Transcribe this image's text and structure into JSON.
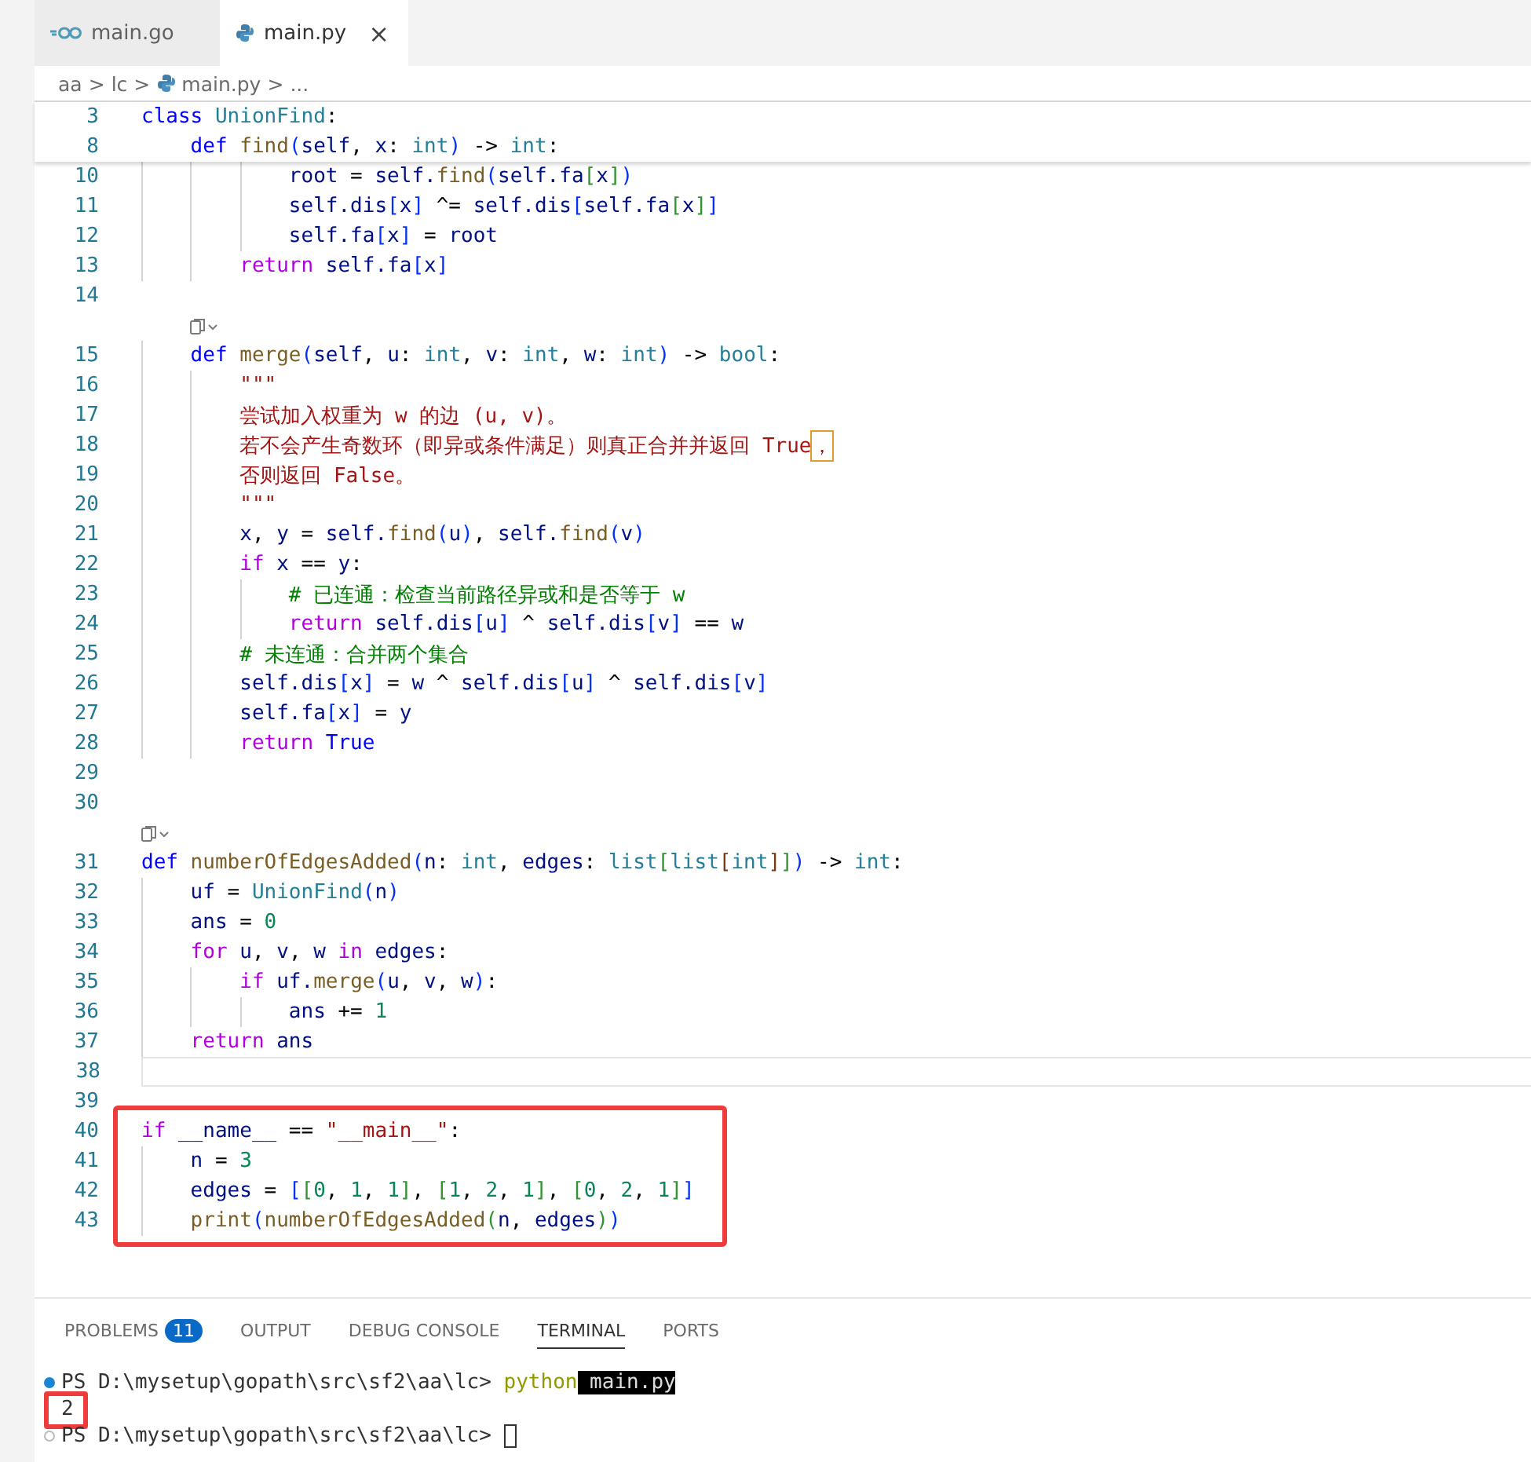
{
  "tabs": [
    {
      "label": "main.go",
      "selected": false
    },
    {
      "label": "main.py",
      "selected": true,
      "close": "×"
    }
  ],
  "breadcrumb": [
    {
      "label": "aa",
      "kind": "folder"
    },
    {
      "label": "lc",
      "kind": "folder"
    },
    {
      "label": "main.py",
      "kind": "file"
    },
    {
      "label": "...",
      "kind": "more"
    }
  ],
  "breadcrumb_separator": ">",
  "sticky_lines": [
    {
      "number": "3",
      "tokens": [
        {
          "text": "class",
          "kind": "kw"
        },
        {
          "text": " UnionFind",
          "kind": "cls"
        },
        {
          "text": ":",
          "kind": "p"
        }
      ]
    },
    {
      "number": "8",
      "tokens": [
        {
          "text": "    def",
          "kind": "kw"
        },
        {
          "text": " find",
          "kind": "fn"
        },
        {
          "text": "(",
          "kind": "br1"
        },
        {
          "text": "self",
          "kind": "var"
        },
        {
          "text": ", ",
          "kind": "p"
        },
        {
          "text": "x",
          "kind": "var"
        },
        {
          "text": ": ",
          "kind": "p"
        },
        {
          "text": "int",
          "kind": "cls"
        },
        {
          "text": ")",
          "kind": "br1"
        },
        {
          "text": " -> ",
          "kind": "p"
        },
        {
          "text": "int",
          "kind": "cls"
        },
        {
          "text": ":",
          "kind": "p"
        }
      ]
    }
  ],
  "blocks": [
    {
      "annotated": false,
      "lines": [
        {
          "kind": "code",
          "number": "10",
          "tokens": [
            {
              "text": "            root",
              "kind": "var"
            },
            {
              "text": " = ",
              "kind": "p"
            },
            {
              "text": "self.",
              "kind": "var"
            },
            {
              "text": "find",
              "kind": "fn"
            },
            {
              "text": "(",
              "kind": "br1"
            },
            {
              "text": "self.fa",
              "kind": "var"
            },
            {
              "text": "[",
              "kind": "br2"
            },
            {
              "text": "x",
              "kind": "var"
            },
            {
              "text": "]",
              "kind": "br2"
            },
            {
              "text": ")",
              "kind": "br1"
            }
          ]
        },
        {
          "kind": "code",
          "number": "11",
          "tokens": [
            {
              "text": "            self.dis",
              "kind": "var"
            },
            {
              "text": "[",
              "kind": "br1"
            },
            {
              "text": "x",
              "kind": "var"
            },
            {
              "text": "]",
              "kind": "br1"
            },
            {
              "text": " ^= ",
              "kind": "p"
            },
            {
              "text": "self.dis",
              "kind": "var"
            },
            {
              "text": "[",
              "kind": "br1"
            },
            {
              "text": "self.fa",
              "kind": "var"
            },
            {
              "text": "[",
              "kind": "br2"
            },
            {
              "text": "x",
              "kind": "var"
            },
            {
              "text": "]",
              "kind": "br2"
            },
            {
              "text": "]",
              "kind": "br1"
            }
          ]
        },
        {
          "kind": "code",
          "number": "12",
          "tokens": [
            {
              "text": "            self.fa",
              "kind": "var"
            },
            {
              "text": "[",
              "kind": "br1"
            },
            {
              "text": "x",
              "kind": "var"
            },
            {
              "text": "]",
              "kind": "br1"
            },
            {
              "text": " = ",
              "kind": "p"
            },
            {
              "text": "root",
              "kind": "var"
            }
          ]
        },
        {
          "kind": "code",
          "number": "13",
          "tokens": [
            {
              "text": "        return",
              "kind": "ctrl"
            },
            {
              "text": " self.fa",
              "kind": "var"
            },
            {
              "text": "[",
              "kind": "br1"
            },
            {
              "text": "x",
              "kind": "var"
            },
            {
              "text": "]",
              "kind": "br1"
            }
          ]
        },
        {
          "kind": "code",
          "number": "14"
        },
        {
          "kind": "codelens",
          "nested": true
        },
        {
          "kind": "code",
          "number": "15",
          "tokens": [
            {
              "text": "    def",
              "kind": "kw"
            },
            {
              "text": " merge",
              "kind": "fn"
            },
            {
              "text": "(",
              "kind": "br1"
            },
            {
              "text": "self",
              "kind": "var"
            },
            {
              "text": ", ",
              "kind": "p"
            },
            {
              "text": "u",
              "kind": "var"
            },
            {
              "text": ": ",
              "kind": "p"
            },
            {
              "text": "int",
              "kind": "cls"
            },
            {
              "text": ", ",
              "kind": "p"
            },
            {
              "text": "v",
              "kind": "var"
            },
            {
              "text": ": ",
              "kind": "p"
            },
            {
              "text": "int",
              "kind": "cls"
            },
            {
              "text": ", ",
              "kind": "p"
            },
            {
              "text": "w",
              "kind": "var"
            },
            {
              "text": ": ",
              "kind": "p"
            },
            {
              "text": "int",
              "kind": "cls"
            },
            {
              "text": ")",
              "kind": "br1"
            },
            {
              "text": " -> ",
              "kind": "p"
            },
            {
              "text": "bool",
              "kind": "cls"
            },
            {
              "text": ":",
              "kind": "p"
            }
          ]
        },
        {
          "kind": "code",
          "number": "16",
          "tokens": [
            {
              "text": "        \"\"\"",
              "kind": "str"
            }
          ]
        },
        {
          "kind": "code",
          "number": "17",
          "tokens": [
            {
              "text": "        尝试加入权重为 w 的边 (u, v)。",
              "kind": "str"
            }
          ]
        },
        {
          "kind": "code",
          "number": "18",
          "tokens": [
            {
              "text": "        若不会产生奇数环（即异或条件满足）则真正合并并返回 True",
              "kind": "str"
            },
            {
              "text": "，",
              "kind": "str",
              "boxed": true
            }
          ]
        },
        {
          "kind": "code",
          "number": "19",
          "tokens": [
            {
              "text": "        否则返回 False。",
              "kind": "str"
            }
          ]
        },
        {
          "kind": "code",
          "number": "20",
          "tokens": [
            {
              "text": "        \"\"\"",
              "kind": "str"
            }
          ]
        },
        {
          "kind": "code",
          "number": "21",
          "tokens": [
            {
              "text": "        x",
              "kind": "var"
            },
            {
              "text": ", ",
              "kind": "p"
            },
            {
              "text": "y",
              "kind": "var"
            },
            {
              "text": " = ",
              "kind": "p"
            },
            {
              "text": "self.",
              "kind": "var"
            },
            {
              "text": "find",
              "kind": "fn"
            },
            {
              "text": "(",
              "kind": "br1"
            },
            {
              "text": "u",
              "kind": "var"
            },
            {
              "text": ")",
              "kind": "br1"
            },
            {
              "text": ", ",
              "kind": "p"
            },
            {
              "text": "self.",
              "kind": "var"
            },
            {
              "text": "find",
              "kind": "fn"
            },
            {
              "text": "(",
              "kind": "br1"
            },
            {
              "text": "v",
              "kind": "var"
            },
            {
              "text": ")",
              "kind": "br1"
            }
          ]
        },
        {
          "kind": "code",
          "number": "22",
          "tokens": [
            {
              "text": "        if",
              "kind": "ctrl"
            },
            {
              "text": " x",
              "kind": "var"
            },
            {
              "text": " == ",
              "kind": "p"
            },
            {
              "text": "y",
              "kind": "var"
            },
            {
              "text": ":",
              "kind": "p"
            }
          ]
        },
        {
          "kind": "code",
          "number": "23",
          "tokens": [
            {
              "text": "            # 已连通：检查当前路径异或和是否等于 w",
              "kind": "cmt"
            }
          ]
        },
        {
          "kind": "code",
          "number": "24",
          "tokens": [
            {
              "text": "            return",
              "kind": "ctrl"
            },
            {
              "text": " self.dis",
              "kind": "var"
            },
            {
              "text": "[",
              "kind": "br1"
            },
            {
              "text": "u",
              "kind": "var"
            },
            {
              "text": "]",
              "kind": "br1"
            },
            {
              "text": " ^ ",
              "kind": "p"
            },
            {
              "text": "self.dis",
              "kind": "var"
            },
            {
              "text": "[",
              "kind": "br1"
            },
            {
              "text": "v",
              "kind": "var"
            },
            {
              "text": "]",
              "kind": "br1"
            },
            {
              "text": " == ",
              "kind": "p"
            },
            {
              "text": "w",
              "kind": "var"
            }
          ]
        },
        {
          "kind": "code",
          "number": "25",
          "tokens": [
            {
              "text": "        # 未连通：合并两个集合",
              "kind": "cmt"
            }
          ]
        },
        {
          "kind": "code",
          "number": "26",
          "tokens": [
            {
              "text": "        self.dis",
              "kind": "var"
            },
            {
              "text": "[",
              "kind": "br1"
            },
            {
              "text": "x",
              "kind": "var"
            },
            {
              "text": "]",
              "kind": "br1"
            },
            {
              "text": " = ",
              "kind": "p"
            },
            {
              "text": "w",
              "kind": "var"
            },
            {
              "text": " ^ ",
              "kind": "p"
            },
            {
              "text": "self.dis",
              "kind": "var"
            },
            {
              "text": "[",
              "kind": "br1"
            },
            {
              "text": "u",
              "kind": "var"
            },
            {
              "text": "]",
              "kind": "br1"
            },
            {
              "text": " ^ ",
              "kind": "p"
            },
            {
              "text": "self.dis",
              "kind": "var"
            },
            {
              "text": "[",
              "kind": "br1"
            },
            {
              "text": "v",
              "kind": "var"
            },
            {
              "text": "]",
              "kind": "br1"
            }
          ]
        },
        {
          "kind": "code",
          "number": "27",
          "tokens": [
            {
              "text": "        self.fa",
              "kind": "var"
            },
            {
              "text": "[",
              "kind": "br1"
            },
            {
              "text": "x",
              "kind": "var"
            },
            {
              "text": "]",
              "kind": "br1"
            },
            {
              "text": " = ",
              "kind": "p"
            },
            {
              "text": "y",
              "kind": "var"
            }
          ]
        },
        {
          "kind": "code",
          "number": "28",
          "tokens": [
            {
              "text": "        return",
              "kind": "ctrl"
            },
            {
              "text": " True",
              "kind": "kw"
            }
          ]
        },
        {
          "kind": "code",
          "number": "29"
        },
        {
          "kind": "code",
          "number": "30"
        },
        {
          "kind": "codelens",
          "nested": false
        },
        {
          "kind": "code",
          "number": "31",
          "tokens": [
            {
              "text": "def",
              "kind": "kw"
            },
            {
              "text": " numberOfEdgesAdded",
              "kind": "fn"
            },
            {
              "text": "(",
              "kind": "br1"
            },
            {
              "text": "n",
              "kind": "var"
            },
            {
              "text": ": ",
              "kind": "p"
            },
            {
              "text": "int",
              "kind": "cls"
            },
            {
              "text": ", ",
              "kind": "p"
            },
            {
              "text": "edges",
              "kind": "var"
            },
            {
              "text": ": ",
              "kind": "p"
            },
            {
              "text": "list",
              "kind": "cls"
            },
            {
              "text": "[",
              "kind": "br2"
            },
            {
              "text": "list",
              "kind": "cls"
            },
            {
              "text": "[",
              "kind": "br3"
            },
            {
              "text": "int",
              "kind": "cls"
            },
            {
              "text": "]",
              "kind": "br3"
            },
            {
              "text": "]",
              "kind": "br2"
            },
            {
              "text": ")",
              "kind": "br1"
            },
            {
              "text": " -> ",
              "kind": "p"
            },
            {
              "text": "int",
              "kind": "cls"
            },
            {
              "text": ":",
              "kind": "p"
            }
          ]
        },
        {
          "kind": "code",
          "number": "32",
          "tokens": [
            {
              "text": "    uf",
              "kind": "var"
            },
            {
              "text": " = ",
              "kind": "p"
            },
            {
              "text": "UnionFind",
              "kind": "cls"
            },
            {
              "text": "(",
              "kind": "br1"
            },
            {
              "text": "n",
              "kind": "var"
            },
            {
              "text": ")",
              "kind": "br1"
            }
          ]
        },
        {
          "kind": "code",
          "number": "33",
          "tokens": [
            {
              "text": "    ans",
              "kind": "var"
            },
            {
              "text": " = ",
              "kind": "p"
            },
            {
              "text": "0",
              "kind": "num"
            }
          ]
        },
        {
          "kind": "code",
          "number": "34",
          "tokens": [
            {
              "text": "    for",
              "kind": "ctrl"
            },
            {
              "text": " u",
              "kind": "var"
            },
            {
              "text": ", ",
              "kind": "p"
            },
            {
              "text": "v",
              "kind": "var"
            },
            {
              "text": ", ",
              "kind": "p"
            },
            {
              "text": "w",
              "kind": "var"
            },
            {
              "text": " in",
              "kind": "ctrl"
            },
            {
              "text": " edges",
              "kind": "var"
            },
            {
              "text": ":",
              "kind": "p"
            }
          ]
        },
        {
          "kind": "code",
          "number": "35",
          "tokens": [
            {
              "text": "        if",
              "kind": "ctrl"
            },
            {
              "text": " uf.",
              "kind": "var"
            },
            {
              "text": "merge",
              "kind": "fn"
            },
            {
              "text": "(",
              "kind": "br1"
            },
            {
              "text": "u",
              "kind": "var"
            },
            {
              "text": ", ",
              "kind": "p"
            },
            {
              "text": "v",
              "kind": "var"
            },
            {
              "text": ", ",
              "kind": "p"
            },
            {
              "text": "w",
              "kind": "var"
            },
            {
              "text": ")",
              "kind": "br1"
            },
            {
              "text": ":",
              "kind": "p"
            }
          ]
        },
        {
          "kind": "code",
          "number": "36",
          "tokens": [
            {
              "text": "            ans",
              "kind": "var"
            },
            {
              "text": " += ",
              "kind": "p"
            },
            {
              "text": "1",
              "kind": "num"
            }
          ]
        },
        {
          "kind": "code",
          "number": "37",
          "tokens": [
            {
              "text": "    return",
              "kind": "ctrl"
            },
            {
              "text": " ans",
              "kind": "var"
            }
          ]
        },
        {
          "kind": "code",
          "number": "38",
          "current": true
        },
        {
          "kind": "code",
          "number": "39"
        }
      ]
    },
    {
      "annotated": true,
      "lines": [
        {
          "kind": "code",
          "number": "40",
          "tokens": [
            {
              "text": "if",
              "kind": "ctrl"
            },
            {
              "text": " __name__",
              "kind": "var"
            },
            {
              "text": " == ",
              "kind": "p"
            },
            {
              "text": "\"__main__\"",
              "kind": "str"
            },
            {
              "text": ":",
              "kind": "p"
            }
          ]
        },
        {
          "kind": "code",
          "number": "41",
          "tokens": [
            {
              "text": "    n",
              "kind": "var"
            },
            {
              "text": " = ",
              "kind": "p"
            },
            {
              "text": "3",
              "kind": "num"
            }
          ]
        },
        {
          "kind": "code",
          "number": "42",
          "tokens": [
            {
              "text": "    edges",
              "kind": "var"
            },
            {
              "text": " = ",
              "kind": "p"
            },
            {
              "text": "[",
              "kind": "br1"
            },
            {
              "text": "[",
              "kind": "br2"
            },
            {
              "text": "0",
              "kind": "num"
            },
            {
              "text": ", ",
              "kind": "p"
            },
            {
              "text": "1",
              "kind": "num"
            },
            {
              "text": ", ",
              "kind": "p"
            },
            {
              "text": "1",
              "kind": "num"
            },
            {
              "text": "]",
              "kind": "br2"
            },
            {
              "text": ", ",
              "kind": "p"
            },
            {
              "text": "[",
              "kind": "br2"
            },
            {
              "text": "1",
              "kind": "num"
            },
            {
              "text": ", ",
              "kind": "p"
            },
            {
              "text": "2",
              "kind": "num"
            },
            {
              "text": ", ",
              "kind": "p"
            },
            {
              "text": "1",
              "kind": "num"
            },
            {
              "text": "]",
              "kind": "br2"
            },
            {
              "text": ", ",
              "kind": "p"
            },
            {
              "text": "[",
              "kind": "br2"
            },
            {
              "text": "0",
              "kind": "num"
            },
            {
              "text": ", ",
              "kind": "p"
            },
            {
              "text": "2",
              "kind": "num"
            },
            {
              "text": ", ",
              "kind": "p"
            },
            {
              "text": "1",
              "kind": "num"
            },
            {
              "text": "]",
              "kind": "br2"
            },
            {
              "text": "]",
              "kind": "br1"
            }
          ]
        },
        {
          "kind": "code",
          "number": "43",
          "tokens": [
            {
              "text": "    print",
              "kind": "fn"
            },
            {
              "text": "(",
              "kind": "br1"
            },
            {
              "text": "numberOfEdgesAdded",
              "kind": "fn"
            },
            {
              "text": "(",
              "kind": "br2"
            },
            {
              "text": "n",
              "kind": "var"
            },
            {
              "text": ", ",
              "kind": "p"
            },
            {
              "text": "edges",
              "kind": "var"
            },
            {
              "text": ")",
              "kind": "br2"
            },
            {
              "text": ")",
              "kind": "br1"
            }
          ]
        }
      ]
    }
  ],
  "panel_tabs": [
    {
      "label": "PROBLEMS",
      "badge": "11",
      "selected": false
    },
    {
      "label": "OUTPUT",
      "selected": false
    },
    {
      "label": "DEBUG CONSOLE",
      "selected": false
    },
    {
      "label": "TERMINAL",
      "selected": true
    },
    {
      "label": "PORTS",
      "selected": false
    }
  ],
  "terminal": [
    {
      "kind": "prompt",
      "succeeded": true,
      "prompt": "PS D:\\mysetup\\gopath\\src\\sf2\\aa\\lc> ",
      "command": "python",
      "args": " main.py"
    },
    {
      "kind": "output",
      "text": "2",
      "annotated": true
    },
    {
      "kind": "prompt",
      "succeeded": false,
      "prompt": "PS D:\\mysetup\\gopath\\src\\sf2\\aa\\lc> ",
      "cursor": true
    }
  ]
}
